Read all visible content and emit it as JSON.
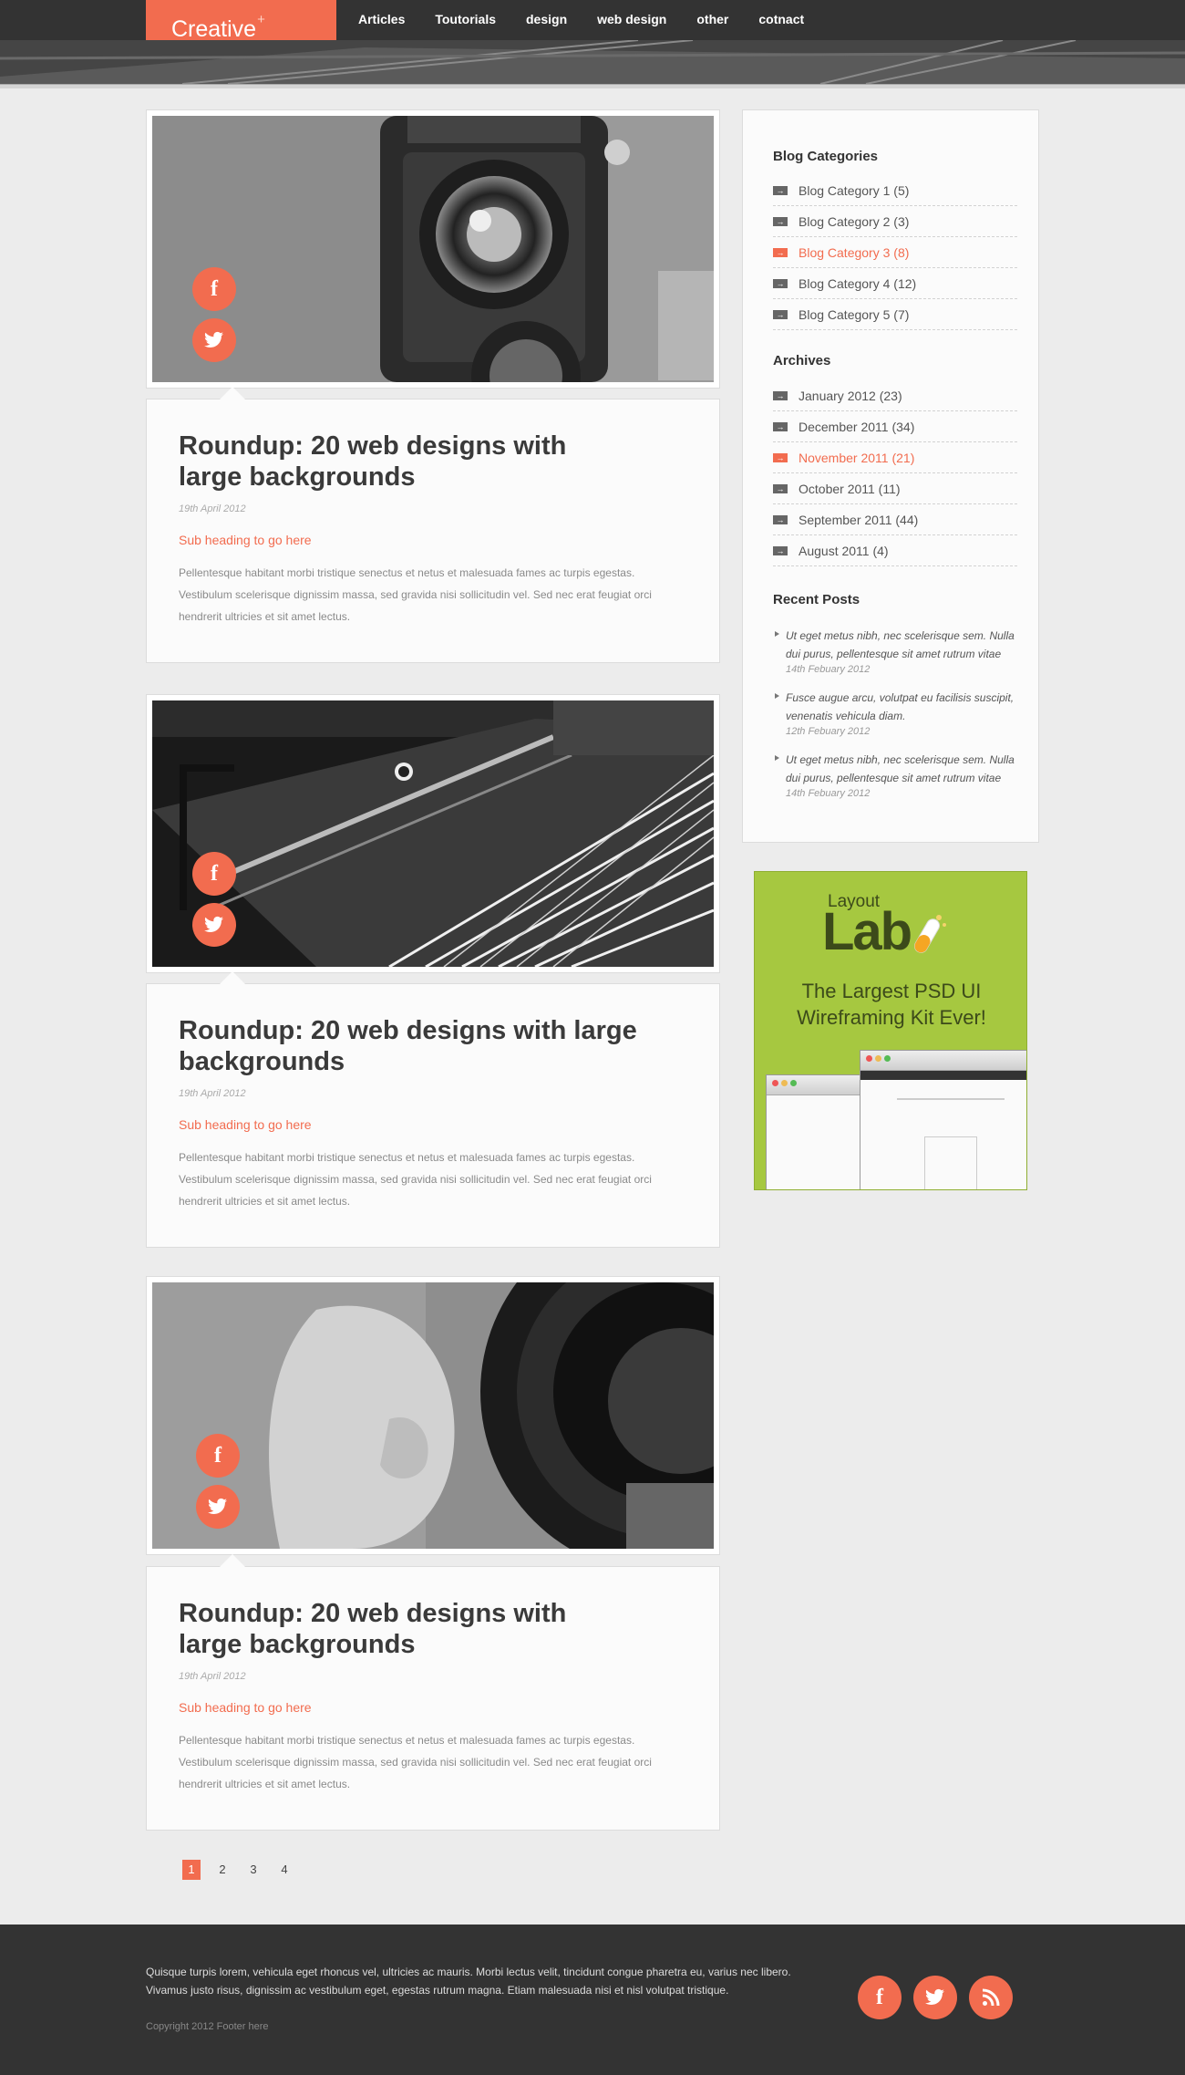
{
  "brand": {
    "name": "Creative",
    "mark": "+"
  },
  "nav": [
    "Articles",
    "Toutorials",
    "design",
    "web design",
    "other",
    "cotnact"
  ],
  "posts": [
    {
      "title": "Roundup: 20 web designs with large backgrounds",
      "date": "19th April 2012",
      "subheading": "Sub heading to go here",
      "body": "Pellentesque habitant morbi tristique senectus et netus et malesuada fames ac turpis egestas. Vestibulum scelerisque dignissim massa, sed gravida nisi sollicitudin vel. Sed nec erat feugiat orci hendrerit ultricies et sit amet lectus."
    },
    {
      "title": "Roundup: 20 web designs with large backgrounds",
      "date": "19th April 2012",
      "subheading": "Sub heading to go here",
      "body": "Pellentesque habitant morbi tristique senectus et netus et malesuada fames ac turpis egestas. Vestibulum scelerisque dignissim massa, sed gravida nisi sollicitudin vel. Sed nec erat feugiat orci hendrerit ultricies et sit amet lectus."
    },
    {
      "title": "Roundup: 20 web designs with large backgrounds",
      "date": "19th April 2012",
      "subheading": "Sub heading to go here",
      "body": "Pellentesque habitant morbi tristique senectus et netus et malesuada fames ac turpis egestas. Vestibulum scelerisque dignissim massa, sed gravida nisi sollicitudin vel. Sed nec erat feugiat orci hendrerit ultricies et sit amet lectus."
    }
  ],
  "social": {
    "facebook": "f",
    "icons": [
      "facebook-icon",
      "twitter-icon",
      "rss-icon"
    ]
  },
  "sidebar": {
    "categories_heading": "Blog Categories",
    "categories": [
      {
        "label": "Blog Category 1 (5)",
        "active": false
      },
      {
        "label": "Blog Category 2 (3)",
        "active": false
      },
      {
        "label": "Blog Category 3 (8)",
        "active": true
      },
      {
        "label": "Blog Category 4 (12)",
        "active": false
      },
      {
        "label": "Blog Category 5 (7)",
        "active": false
      }
    ],
    "archives_heading": "Archives",
    "archives": [
      {
        "label": "January 2012 (23)",
        "active": false
      },
      {
        "label": "December 2011 (34)",
        "active": false
      },
      {
        "label": "November 2011 (21)",
        "active": true
      },
      {
        "label": "October 2011 (11)",
        "active": false
      },
      {
        "label": "September 2011 (44)",
        "active": false
      },
      {
        "label": "August 2011 (4)",
        "active": false
      }
    ],
    "recent_heading": "Recent Posts",
    "recent": [
      {
        "text": "Ut eget metus nibh, nec scelerisque sem. Nulla dui purus, pellentesque sit amet rutrum vitae",
        "date": "14th Febuary 2012"
      },
      {
        "text": "Fusce augue arcu, volutpat eu facilisis suscipit, venenatis vehicula diam.",
        "date": "12th Febuary 2012"
      },
      {
        "text": "Ut eget metus nibh, nec scelerisque sem. Nulla dui purus, pellentesque sit amet rutrum vitae",
        "date": "14th Febuary 2012"
      }
    ]
  },
  "ad": {
    "logo_top": "Layout",
    "logo_main": "Lab",
    "tagline": "The Largest PSD UI Wireframing Kit Ever!"
  },
  "pagination": {
    "pages": [
      "1",
      "2",
      "3",
      "4"
    ],
    "current": "1"
  },
  "footer": {
    "text": "Quisque turpis lorem, vehicula eget rhoncus vel, ultricies ac mauris. Morbi lectus velit, tincidunt congue pharetra eu, varius nec libero. Vivamus justo risus, dignissim ac vestibulum eget, egestas rutrum magna. Etiam malesuada nisi et nisl volutpat tristique.",
    "copyright": "Copyright 2012 Footer here"
  },
  "colors": {
    "accent": "#f26c4f",
    "dark": "#333333",
    "ad_green": "#a6c840"
  }
}
